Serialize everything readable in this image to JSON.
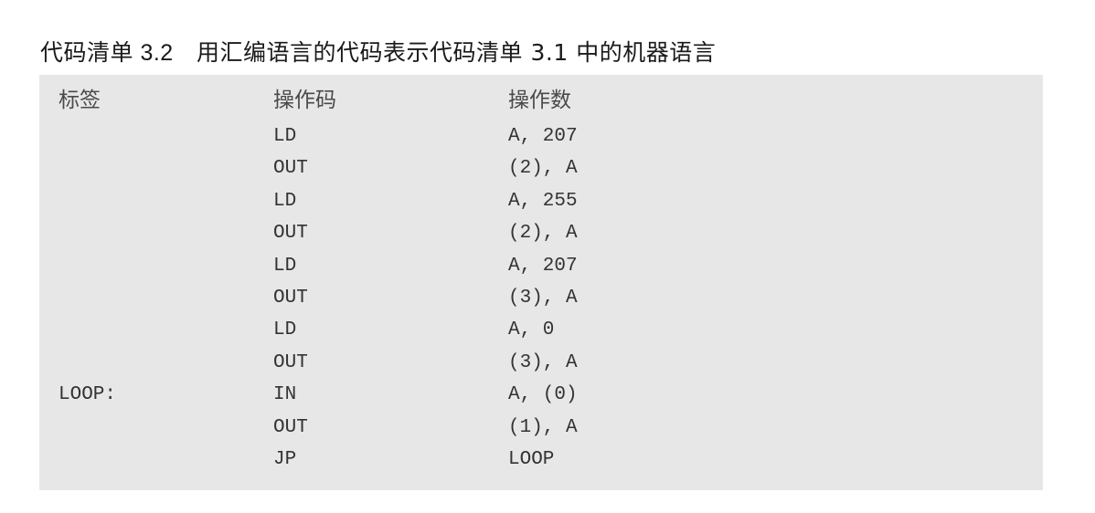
{
  "caption": {
    "number": "代码清单 3.2",
    "title": "用汇编语言的代码表示代码清单 3.1 中的机器语言"
  },
  "listing": {
    "headers": {
      "label": "标签",
      "opcode": "操作码",
      "operand": "操作数"
    },
    "rows": [
      {
        "label": "",
        "opcode": "LD",
        "operand": "A, 207"
      },
      {
        "label": "",
        "opcode": "OUT",
        "operand": "(2), A"
      },
      {
        "label": "",
        "opcode": "LD",
        "operand": "A, 255"
      },
      {
        "label": "",
        "opcode": "OUT",
        "operand": "(2), A"
      },
      {
        "label": "",
        "opcode": "LD",
        "operand": "A, 207"
      },
      {
        "label": "",
        "opcode": "OUT",
        "operand": "(3), A"
      },
      {
        "label": "",
        "opcode": "LD",
        "operand": "A, 0"
      },
      {
        "label": "",
        "opcode": "OUT",
        "operand": "(3), A"
      },
      {
        "label": "LOOP:",
        "opcode": "IN",
        "operand": "A, (0)"
      },
      {
        "label": "",
        "opcode": "OUT",
        "operand": "(1), A"
      },
      {
        "label": "",
        "opcode": "JP",
        "operand": "LOOP"
      }
    ]
  }
}
